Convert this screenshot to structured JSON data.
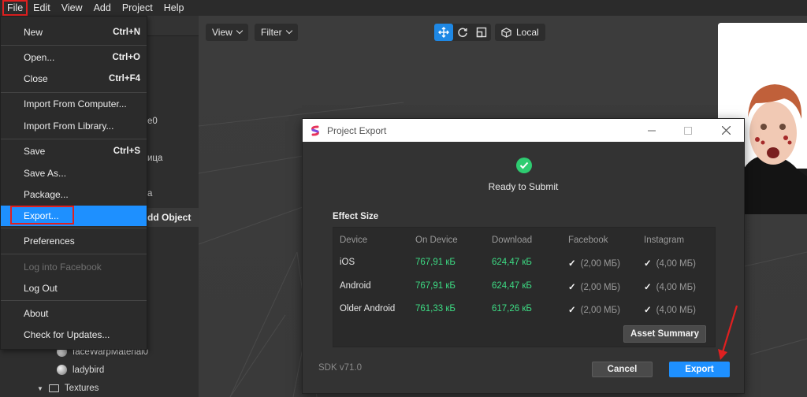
{
  "menubar": [
    "File",
    "Edit",
    "View",
    "Add",
    "Project",
    "Help"
  ],
  "left_panel": {
    "fragments": [
      "e0",
      "ица",
      "a"
    ],
    "add_object": "dd Object",
    "tree": [
      {
        "label": "faceWarpMaterial0",
        "icon": "sphere-icon"
      },
      {
        "label": "ladybird",
        "icon": "sphere-icon"
      },
      {
        "label": "Textures",
        "icon": "folder-icon"
      }
    ]
  },
  "viewport": {
    "view_btn": "View",
    "filter_btn": "Filter",
    "local_btn": "Local"
  },
  "file_menu": {
    "items": [
      {
        "label": "New",
        "shortcut": "Ctrl+N"
      },
      {
        "label": "Open...",
        "shortcut": "Ctrl+O"
      },
      {
        "label": "Close",
        "shortcut": "Ctrl+F4"
      },
      {
        "label": "Import From Computer...",
        "shortcut": ""
      },
      {
        "label": "Import From Library...",
        "shortcut": ""
      },
      {
        "label": "Save",
        "shortcut": "Ctrl+S"
      },
      {
        "label": "Save As...",
        "shortcut": ""
      },
      {
        "label": "Package...",
        "shortcut": ""
      },
      {
        "label": "Export...",
        "shortcut": ""
      },
      {
        "label": "Preferences",
        "shortcut": ""
      },
      {
        "label": "Log into Facebook",
        "shortcut": ""
      },
      {
        "label": "Log Out",
        "shortcut": ""
      },
      {
        "label": "About",
        "shortcut": ""
      },
      {
        "label": "Check for Updates...",
        "shortcut": ""
      }
    ]
  },
  "dialog": {
    "title": "Project Export",
    "status": "Ready to Submit",
    "effect_size_label": "Effect Size",
    "columns": [
      "Device",
      "On Device",
      "Download",
      "Facebook",
      "Instagram"
    ],
    "rows": [
      {
        "device": "iOS",
        "on_device": "767,91 кБ",
        "download": "624,47 кБ",
        "facebook": "(2,00 МБ)",
        "instagram": "(4,00 МБ)"
      },
      {
        "device": "Android",
        "on_device": "767,91 кБ",
        "download": "624,47 кБ",
        "facebook": "(2,00 МБ)",
        "instagram": "(4,00 МБ)"
      },
      {
        "device": "Older Android",
        "on_device": "761,33 кБ",
        "download": "617,26 кБ",
        "facebook": "(2,00 МБ)",
        "instagram": "(4,00 МБ)"
      }
    ],
    "asset_summary": "Asset Summary",
    "sdk": "SDK v71.0",
    "cancel": "Cancel",
    "export": "Export"
  },
  "colors": {
    "accent": "#1e90ff",
    "success": "#2ecc71",
    "highlight_box": "#e02020"
  }
}
